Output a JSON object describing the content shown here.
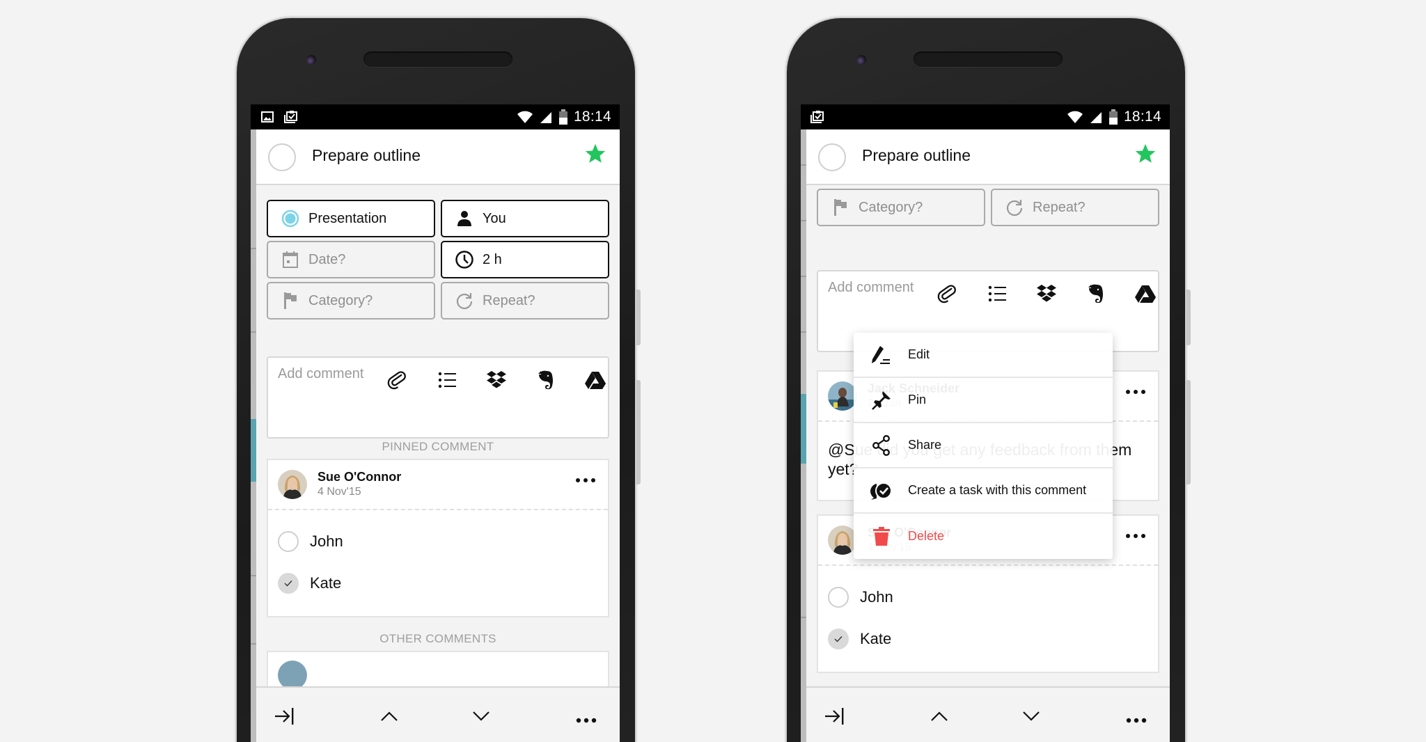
{
  "status_bar": {
    "time": "18:14"
  },
  "task": {
    "title": "Prepare outline",
    "starred": true,
    "star_color": "#22c55e"
  },
  "fields": {
    "project": {
      "label": "Presentation",
      "icon": "project-circle-icon",
      "color": "#7dd3e8"
    },
    "assignee": {
      "label": "You",
      "icon": "person-icon"
    },
    "date": {
      "label": "Date?",
      "icon": "calendar-icon"
    },
    "duration": {
      "label": "2 h",
      "icon": "clock-icon"
    },
    "category": {
      "label": "Category?",
      "icon": "flag-icon"
    },
    "repeat": {
      "label": "Repeat?",
      "icon": "repeat-icon"
    }
  },
  "comment_input": {
    "placeholder": "Add comment",
    "tools": [
      "attach-icon",
      "checklist-icon",
      "dropbox-icon",
      "evernote-icon",
      "google-drive-icon"
    ]
  },
  "sections": {
    "pinned": "PINNED COMMENT",
    "other": "OTHER COMMENTS"
  },
  "pinned_comment": {
    "author": "Sue O'Connor",
    "date": "4 Nov'15",
    "checklist": [
      {
        "label": "John",
        "done": false
      },
      {
        "label": "Kate",
        "done": true
      }
    ]
  },
  "other_comment": {
    "author": "Jack Schneider",
    "date": "29 Jan",
    "text": "@Sue did you get any feedback from them yet?"
  },
  "context_menu": {
    "items": [
      {
        "label": "Edit",
        "icon": "edit-icon"
      },
      {
        "label": "Pin",
        "icon": "pin-icon"
      },
      {
        "label": "Share",
        "icon": "share-icon"
      },
      {
        "label": "Create a task with this comment",
        "icon": "create-task-icon"
      },
      {
        "label": "Delete",
        "icon": "trash-icon",
        "color": "#f24a4a"
      }
    ]
  },
  "bottom_bar": [
    "collapse-icon",
    "previous-icon",
    "next-icon",
    "more-icon"
  ]
}
